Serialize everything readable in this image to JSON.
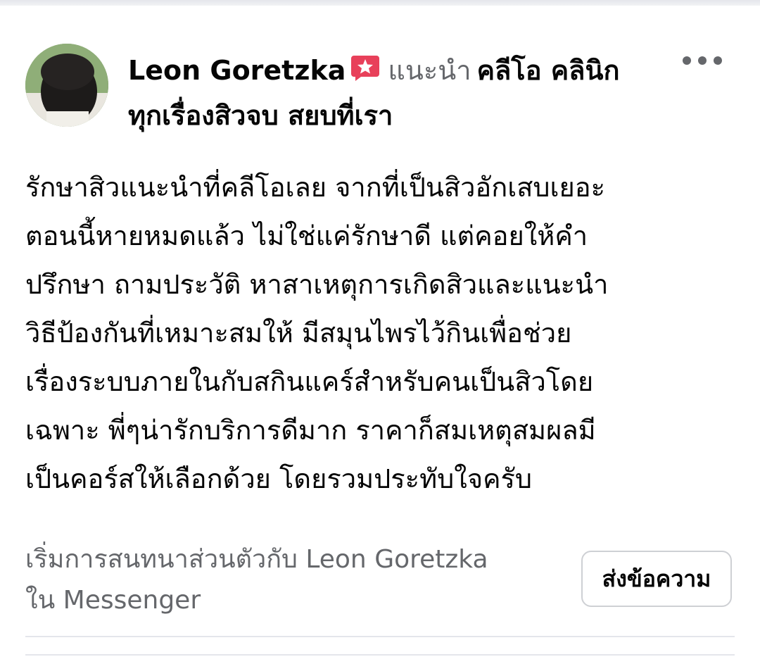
{
  "post": {
    "author": "Leon Goretzka",
    "recommends_label": "แนะนำ",
    "page_name": "คลีโอ คลินิก ทุกเรื่องสิวจบ สยบที่เรา",
    "body": "รักษาสิวแนะนำที่คลีโอเลย จากที่เป็นสิวอักเสบเยอะ\nตอนนี้หายหมดแล้ว ไม่ใช่แค่รักษาดี แต่คอยให้คำ\nปรึกษา ถามประวัติ หาสาเหตุการเกิดสิวและแนะนำ\nวิธีป้องกันที่เหมาะสมให้ มีสมุนไพรไว้กินเพื่อช่วย\nเรื่องระบบภายในกับสกินแคร์สำหรับคนเป็นสิวโดย\nเฉพาะ พี่ๆน่ารักบริการดีมาก ราคาก็สมเหตุสมผลมี\nเป็นคอร์สให้เลือกด้วย โดยรวมประทับใจครับ"
  },
  "messenger": {
    "prompt_line1": "เริ่มการสนทนาส่วนตัวกับ Leon Goretzka",
    "prompt_line2": "ใน Messenger",
    "send_button_label": "ส่งข้อความ"
  },
  "icons": {
    "more": "more-horizontal-icon",
    "badge": "recommends-star-badge-icon",
    "avatar": "profile-photo-avatar"
  },
  "colors": {
    "badge": "#e8405a",
    "secondary_text": "#65676b",
    "primary_text": "#050505",
    "border": "#ced0d4"
  }
}
